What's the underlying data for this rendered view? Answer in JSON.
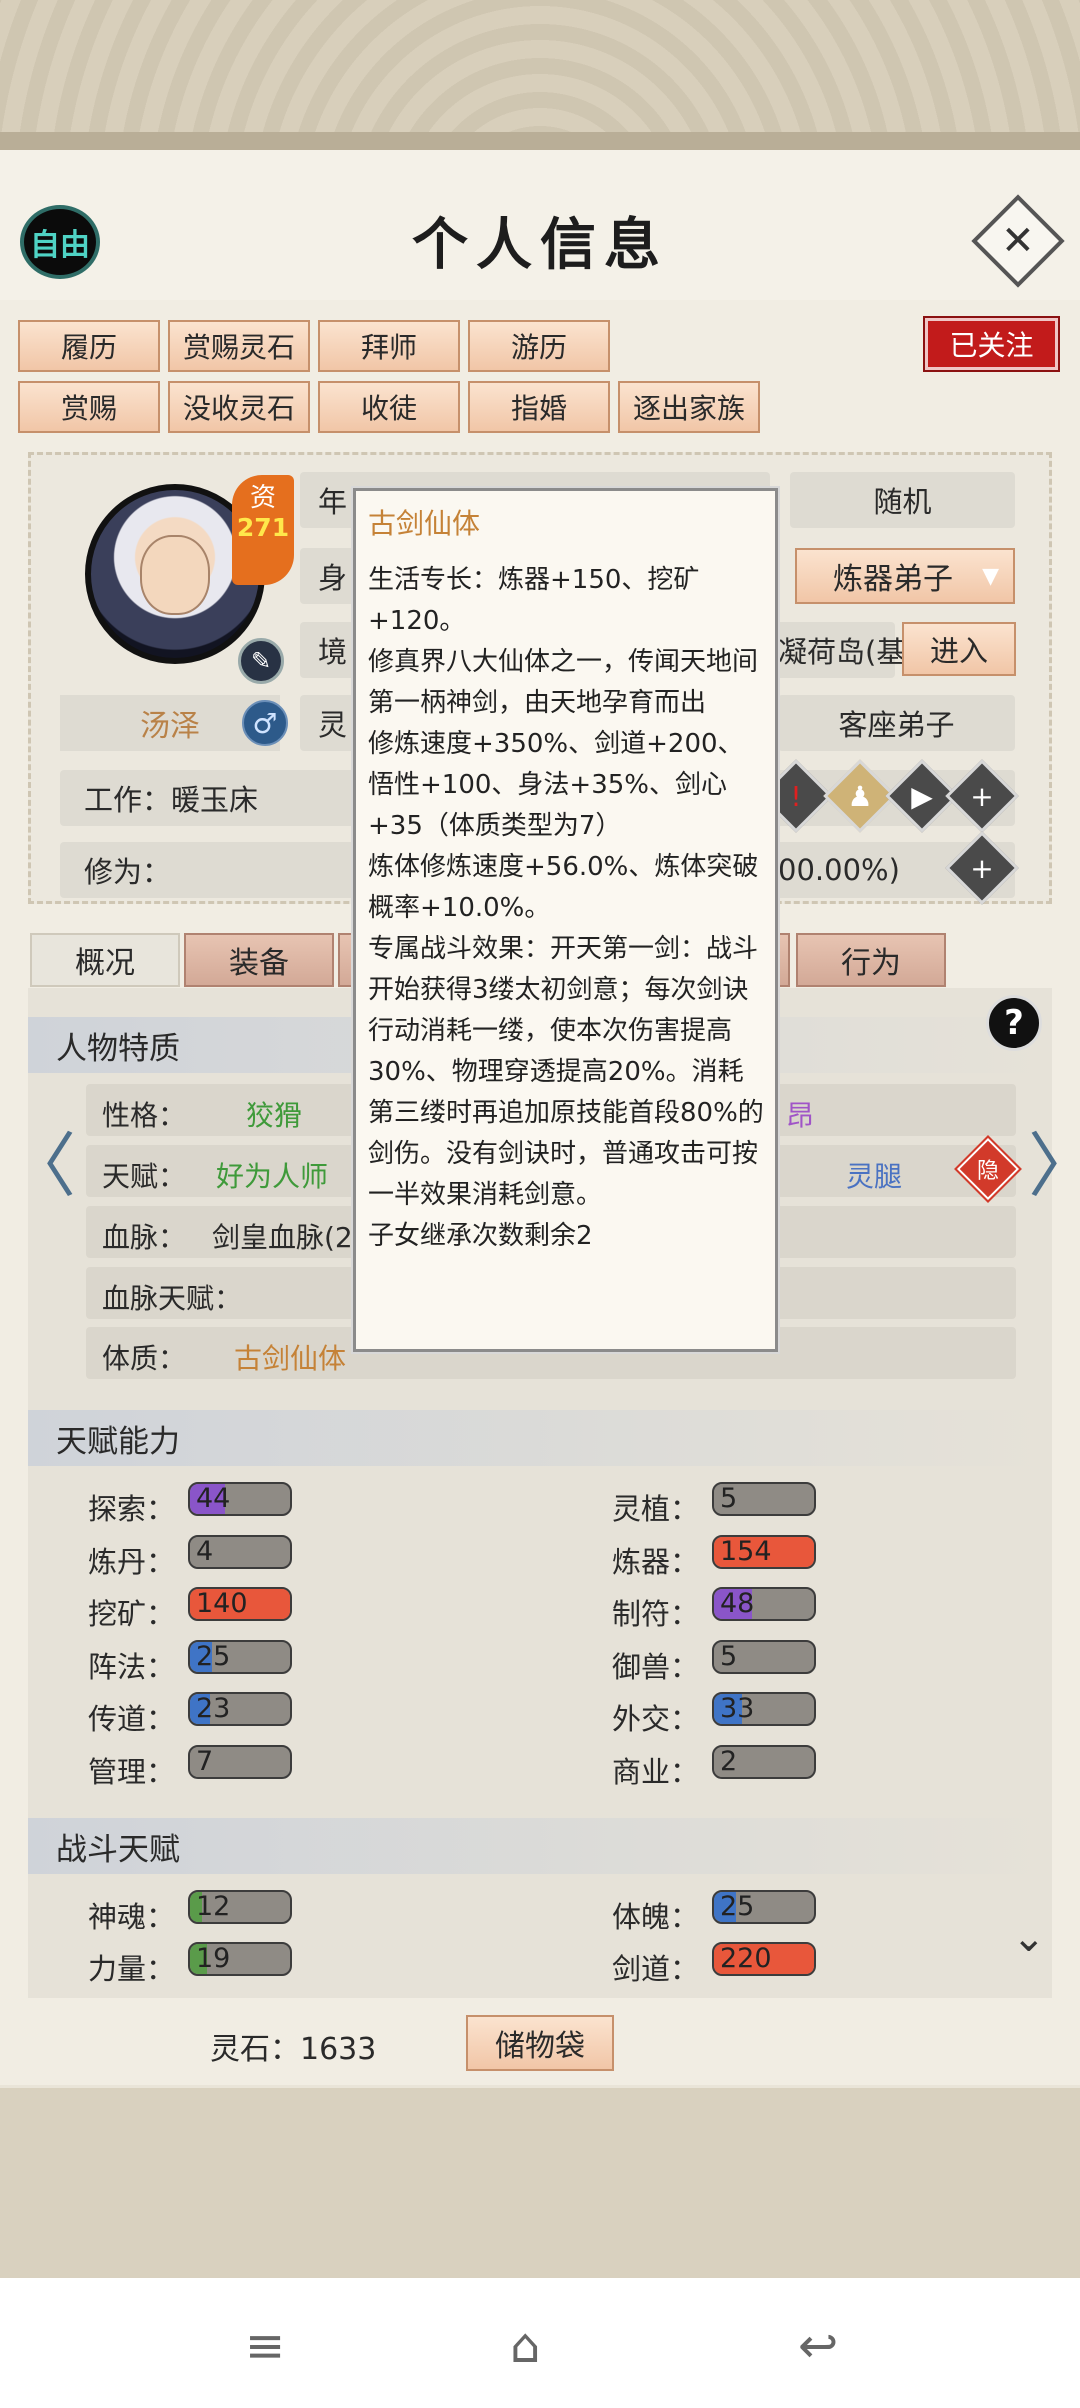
{
  "header": {
    "free_label": "自由",
    "title": "个人信息"
  },
  "actions": {
    "row1": [
      "履历",
      "赏赐灵石",
      "拜师",
      "游历"
    ],
    "row2": [
      "赏赐",
      "没收灵石",
      "收徒",
      "指婚",
      "逐出家族"
    ],
    "follow": "已关注"
  },
  "profile": {
    "qualification_label": "资",
    "qualification_value": "271",
    "name": "汤泽",
    "gender_icon": "♂",
    "random_btn": "随机",
    "position_select": "炼器弟子",
    "location": "凝荷岛(基",
    "enter_btn": "进入",
    "rank": "客座弟子",
    "work": "工作：暖玉床",
    "cultivation_label": "修为：",
    "cultivation_pct": "00.00%)",
    "partial_age": "年",
    "partial_body": "身",
    "partial_realm": "境",
    "partial_spirit": "灵"
  },
  "tabs": [
    "概况",
    "装备",
    "行为"
  ],
  "traits": {
    "section": "人物特质",
    "personality_label": "性格：",
    "personality_value": "狡猾",
    "personality_extra": "昂",
    "talent_label": "天赋：",
    "talent_value": "好为人师",
    "talent_extra": "灵腿",
    "hidden_badge": "隐",
    "bloodline_label": "血脉：",
    "bloodline_value": "剑皇血脉(2",
    "bloodline_talent_label": "血脉天赋：",
    "physique_label": "体质：",
    "physique_value": "古剑仙体"
  },
  "talent_abilities": {
    "section": "天赋能力",
    "left": [
      {
        "label": "探索：",
        "value": "44",
        "level": 0.35,
        "color": "#8a55c9"
      },
      {
        "label": "炼丹：",
        "value": "4",
        "level": 0.04,
        "color": "#8f8b85"
      },
      {
        "label": "挖矿：",
        "value": "140",
        "level": 1.0,
        "color": "#e8573b"
      },
      {
        "label": "阵法：",
        "value": "25",
        "level": 0.22,
        "color": "#3f74c6"
      },
      {
        "label": "传道：",
        "value": "23",
        "level": 0.2,
        "color": "#3f74c6"
      },
      {
        "label": "管理：",
        "value": "7",
        "level": 0.06,
        "color": "#8f8b85"
      }
    ],
    "right": [
      {
        "label": "灵植：",
        "value": "5",
        "level": 0.05,
        "color": "#8f8b85"
      },
      {
        "label": "炼器：",
        "value": "154",
        "level": 1.0,
        "color": "#e8573b"
      },
      {
        "label": "制符：",
        "value": "48",
        "level": 0.38,
        "color": "#8a55c9"
      },
      {
        "label": "御兽：",
        "value": "5",
        "level": 0.05,
        "color": "#8f8b85"
      },
      {
        "label": "外交：",
        "value": "33",
        "level": 0.28,
        "color": "#3f74c6"
      },
      {
        "label": "商业：",
        "value": "2",
        "level": 0.02,
        "color": "#8f8b85"
      }
    ]
  },
  "combat": {
    "section": "战斗天赋",
    "left": [
      {
        "label": "神魂：",
        "value": "12",
        "level": 0.12,
        "color": "#5a9b4a"
      },
      {
        "label": "力量：",
        "value": "19",
        "level": 0.17,
        "color": "#5a9b4a"
      }
    ],
    "right": [
      {
        "label": "体魄：",
        "value": "25",
        "level": 0.22,
        "color": "#3f74c6"
      },
      {
        "label": "剑道：",
        "value": "220",
        "level": 1.0,
        "color": "#e8573b"
      }
    ]
  },
  "footer": {
    "spirit_stones": "灵石：1633",
    "bag_btn": "储物袋"
  },
  "tooltip": {
    "title": "古剑仙体",
    "body": "生活专长：炼器+150、挖矿+120。\n修真界八大仙体之一，传闻天地间第一柄神剑，由天地孕育而出\n修炼速度+350%、剑道+200、悟性+100、身法+35%、剑心+35（体质类型为7）\n炼体修炼速度+56.0%、炼体突破概率+10.0%。\n专属战斗效果：开天第一剑：战斗开始获得3缕太初剑意；每次剑诀行动消耗一缕，使本次伤害提高30%、物理穿透提高20%。消耗第三缕时再追加原技能首段80%的剑伤。没有剑诀时，普通攻击可按一半效果消耗剑意。\n子女继承次数剩余2"
  },
  "icons": {
    "close": "close-icon",
    "edit": "brush-icon",
    "help": "?",
    "left_arrow": "〈",
    "right_arrow": "〉",
    "chevron": "⌄",
    "menu": "≡",
    "home": "⌂",
    "back": "↩"
  }
}
